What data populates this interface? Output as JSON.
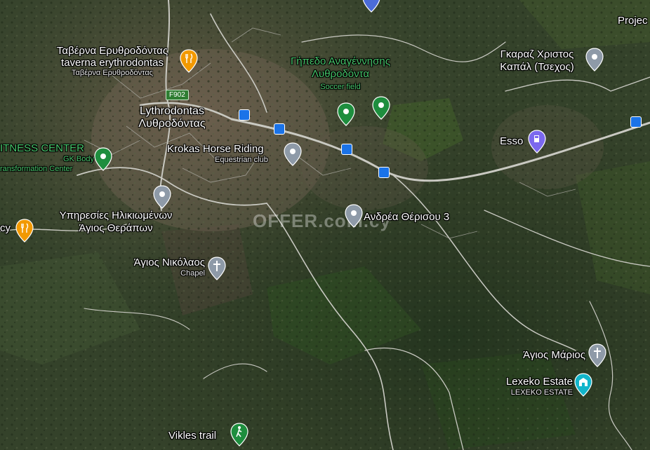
{
  "map": {
    "colors": {
      "terrain_dark": "#2f3a24",
      "road": "#c9c9c2",
      "pin_gray": "#8e9aa8",
      "pin_green": "#1e8e3e",
      "pin_orange": "#f29900",
      "pin_teal": "#12b5cb",
      "pin_purple": "#7b68ee",
      "bus_blue": "#1a73e8"
    },
    "labels": {
      "projec": "Projec",
      "taverna_gr": "Ταβέρνα Ερυθροδόντας",
      "taverna_en": "taverna erythrodontas",
      "taverna_sub": "Ταβέρνα Ερυθροδόντας",
      "gipedo_line1": "Γήπεδο Αναγέννησης",
      "gipedo_line2": "Λυθροδόντα",
      "gipedo_sub": "Soccer field",
      "garaz_line1": "Γκαραζ Χριστος",
      "garaz_line2": "Καπάλ (Τσεχος)",
      "road_f902": "F902",
      "lythrodontas_en": "Lythrodontas",
      "lythrodontas_gr": "Λυθροδόντας",
      "fitness": "ITNESS CENTER",
      "gk_line1": "GK Body",
      "gk_line2": "ransformation Center",
      "krokas": "Krokas Horse Riding",
      "krokas_sub": "Equestrian club",
      "esso": "Esso",
      "cy": "cy",
      "ypiresies": "Υπηρεσίες Ηλικιωμένων",
      "agios_therapon": "Άγιος Θεράπων",
      "andrea": "Ανδρέα Θέρισου 3",
      "agios_nikolaos": "Άγιος Νικόλαος",
      "chapel": "Chapel",
      "agios_marios": "Άγιος Μάριος",
      "lexeko": "Lexeko Estate",
      "lexeko_sub": "LEXEKO ESTATE",
      "vikles": "Vikles trail",
      "watermark": "OFFER.com.cy"
    },
    "icons": {
      "food": "fork-knife-icon",
      "place": "place-pin-icon",
      "sports": "sports-pin-icon",
      "fuel": "gas-station-icon",
      "church": "church-cross-icon",
      "estate": "building-icon",
      "hiking": "hiker-icon",
      "bus": "bus-stop-icon"
    }
  }
}
